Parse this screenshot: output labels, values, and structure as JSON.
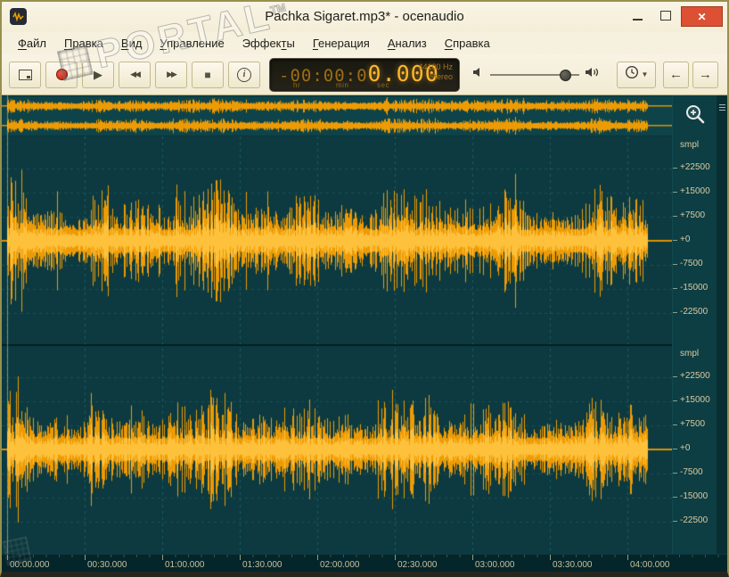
{
  "window": {
    "title": "Pachka Sigaret.mp3* - ocenaudio",
    "controls": {
      "close": "✕"
    }
  },
  "watermark": {
    "text": "PORTAL",
    "tm": "TM"
  },
  "menu": {
    "items": [
      {
        "label": "Файл",
        "u": 0
      },
      {
        "label": "Правка",
        "u": 0
      },
      {
        "label": "Вид",
        "u": 0
      },
      {
        "label": "Управление",
        "u": 0
      },
      {
        "label": "Эффекты",
        "u": 5
      },
      {
        "label": "Генерация",
        "u": 0
      },
      {
        "label": "Анализ",
        "u": 0
      },
      {
        "label": "Справка",
        "u": 0
      }
    ]
  },
  "toolbar": {
    "buttons": [
      {
        "name": "monitor-button",
        "icon": "view"
      },
      {
        "name": "record-button",
        "icon": "record"
      },
      {
        "name": "play-button",
        "icon": "play"
      },
      {
        "name": "rewind-button",
        "icon": "rewind"
      },
      {
        "name": "forward-button",
        "icon": "forward"
      },
      {
        "name": "stop-button",
        "icon": "stop"
      },
      {
        "name": "info-button",
        "icon": "info"
      }
    ],
    "glyphs": {
      "play": "▶",
      "rewind": "◀◀",
      "forward": "▶▶",
      "stop": "■",
      "info": "i"
    },
    "time_display": {
      "dim": "-00:00:0",
      "bright": "0.000",
      "unit_hr": "hr",
      "unit_min": "min",
      "unit_sec": "sec",
      "sample_rate": "44100 Hz",
      "channel_mode": "Stereo"
    },
    "back_glyph": "←",
    "forward_glyph": "→"
  },
  "editor": {
    "ruler_unit": "smpl",
    "ruler_labels": [
      "+22500",
      "+15000",
      "+7500",
      "+0",
      "-7500",
      "-15000",
      "-22500"
    ],
    "channel_count": 2,
    "timeline": [
      "00:00.000",
      "00:30.000",
      "01:00.000",
      "01:30.000",
      "02:00.000",
      "02:30.000",
      "03:00.000",
      "03:30.000",
      "04:00.000"
    ],
    "colors": {
      "background": "#0c3a40",
      "overview_background": "#0e4449",
      "grid": "#1a5a61",
      "grid_h": "#16525a",
      "waveform": "#ed9b05",
      "waveform_core": "#ffc846",
      "zero_line": "#e09200",
      "separator": "#051e22"
    }
  }
}
